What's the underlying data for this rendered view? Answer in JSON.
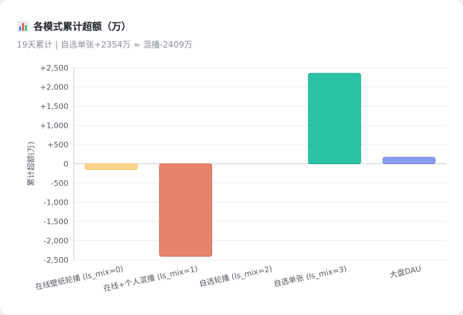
{
  "header": {
    "title": "各模式累计超额（万）",
    "subtitle": "19天累计 | 自选单张+2354万 ≈ 混播-2409万"
  },
  "colors": {
    "grid": "#eceef1",
    "axis": "#c9ccd1"
  },
  "chart_data": {
    "type": "bar",
    "title": "各模式累计超额（万）",
    "ylabel": "累计超额(万)",
    "xlabel": "",
    "ylim": [
      -2500,
      2500
    ],
    "yticks": [
      2500,
      2000,
      1500,
      1000,
      500,
      0,
      -500,
      -1000,
      -1500,
      -2000,
      -2500
    ],
    "ytick_labels": [
      "+2,500",
      "+2,000",
      "+1,500",
      "+1,000",
      "+500",
      "0",
      "-500",
      "-1,000",
      "-1,500",
      "-2,000",
      "-2,500"
    ],
    "grid": true,
    "legend": "none",
    "categories": [
      "在线壁纸轮播 (ls_mix=0)",
      "在线+个人混播 (ls_mix=1)",
      "自选轮播 (ls_mix=2)",
      "自选单张 (ls_mix=3)",
      "大盘DAU"
    ],
    "values": [
      -150,
      -2409,
      0,
      2354,
      170
    ],
    "bar_colors": [
      "#fbd38d",
      "#e8826c",
      "#cccccc",
      "#2ac4a5",
      "#8b9cf0"
    ],
    "bar_edge_colors": [
      "#f5c06a",
      "#cf6a55",
      "#bbbbbb",
      "#1aa68a",
      "#6f82e0"
    ]
  }
}
